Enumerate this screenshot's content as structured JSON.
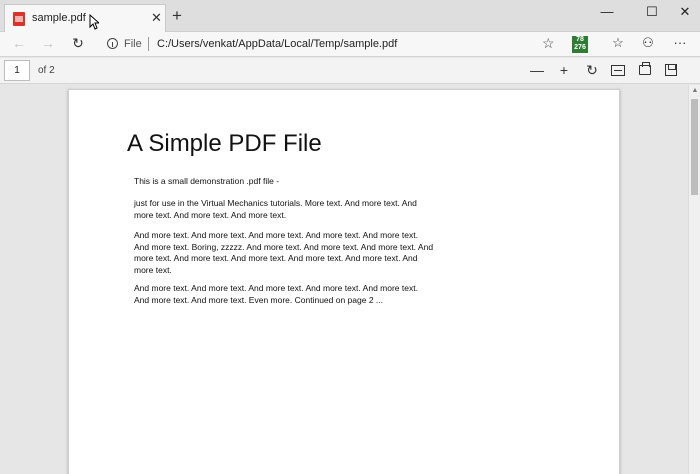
{
  "tab": {
    "title": "sample.pdf",
    "close": "✕"
  },
  "new_tab": "+",
  "window": {
    "minimize": "—",
    "maximize": "☐",
    "close": "✕"
  },
  "nav": {
    "back": "←",
    "forward": "→",
    "refresh": "↻"
  },
  "address": {
    "scheme": "File",
    "url": "C:/Users/venkat/AppData/Local/Temp/sample.pdf",
    "favorite": "☆"
  },
  "extension": {
    "line1": "78",
    "line2": "276"
  },
  "browser_tools": {
    "favorites": "☆",
    "profile": "⚇",
    "more": "···"
  },
  "pdf_toolbar": {
    "page_number": "1",
    "page_count": "of 2",
    "zoom_out": "—",
    "zoom_in": "+",
    "rotate": "↻"
  },
  "document": {
    "title": "A Simple PDF File",
    "paragraphs": [
      "This is a small demonstration .pdf file -",
      "just for use in the Virtual Mechanics tutorials. More text. And more text. And more text. And more text. And more text.",
      "And more text. And more text. And more text. And more text. And more text. And more text. Boring, zzzzz. And more text. And more text. And more text. And more text. And more text. And more text. And more text. And more text. And more text.",
      "And more text. And more text. And more text. And more text. And more text. And more text. And more text. Even more. Continued on page 2 ..."
    ]
  },
  "colors": {
    "tab_bar": "#dedede",
    "toolbar": "#f7f7f7",
    "viewer_bg": "#e6e6e6",
    "extension": "#2f7d32"
  }
}
